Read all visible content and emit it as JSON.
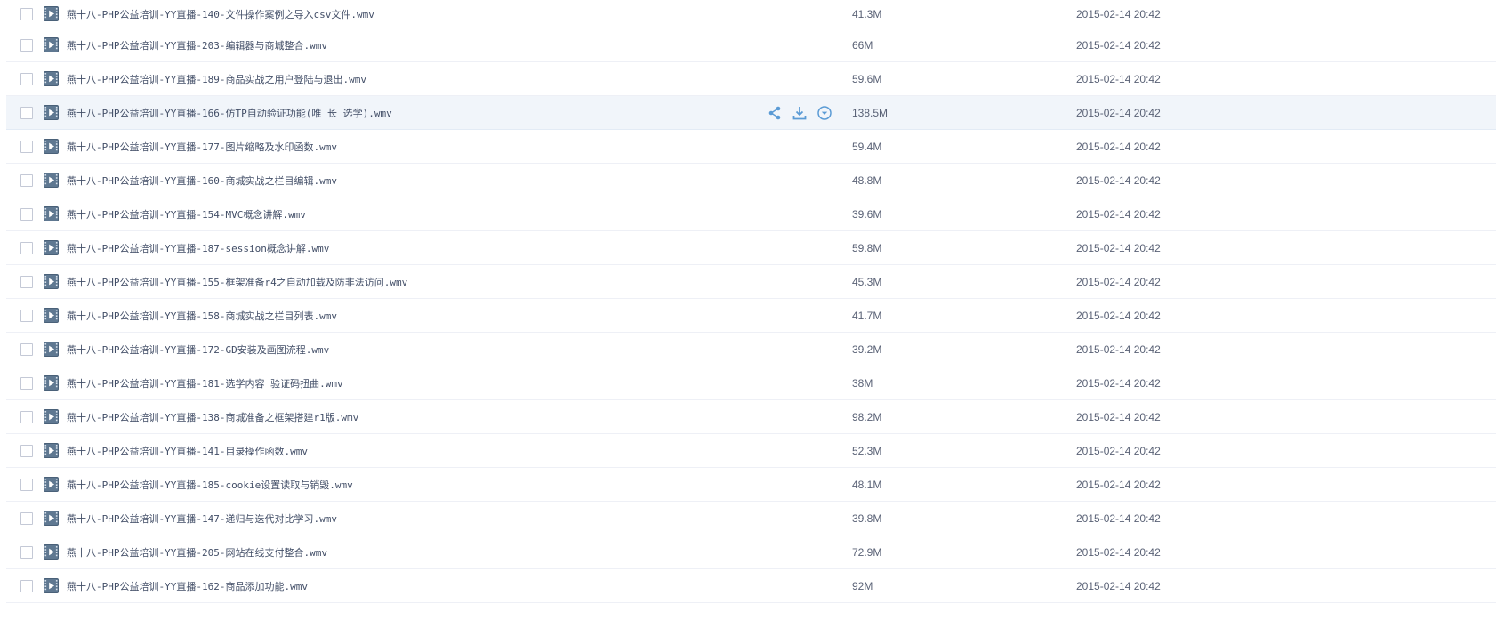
{
  "icons": {
    "file_type": "video-file-icon",
    "share": "share-icon",
    "download": "download-icon",
    "more": "chevron-down-circle-icon"
  },
  "colors": {
    "video_icon": "#5f7891",
    "action_icon": "#5b9bd5",
    "hover_row_bg": "#f1f5fa"
  },
  "files": [
    {
      "name": "燕十八-PHP公益培训-YY直播-140-文件操作案例之导入csv文件.wmv",
      "size": "41.3M",
      "modified": "2015-02-14 20:42",
      "hovered": false
    },
    {
      "name": "燕十八-PHP公益培训-YY直播-203-编辑器与商城整合.wmv",
      "size": "66M",
      "modified": "2015-02-14 20:42",
      "hovered": false
    },
    {
      "name": "燕十八-PHP公益培训-YY直播-189-商品实战之用户登陆与退出.wmv",
      "size": "59.6M",
      "modified": "2015-02-14 20:42",
      "hovered": false
    },
    {
      "name": "燕十八-PHP公益培训-YY直播-166-仿TP自动验证功能(唯 长 选学).wmv",
      "size": "138.5M",
      "modified": "2015-02-14 20:42",
      "hovered": true
    },
    {
      "name": "燕十八-PHP公益培训-YY直播-177-图片缩略及水印函数.wmv",
      "size": "59.4M",
      "modified": "2015-02-14 20:42",
      "hovered": false
    },
    {
      "name": "燕十八-PHP公益培训-YY直播-160-商城实战之栏目编辑.wmv",
      "size": "48.8M",
      "modified": "2015-02-14 20:42",
      "hovered": false
    },
    {
      "name": "燕十八-PHP公益培训-YY直播-154-MVC概念讲解.wmv",
      "size": "39.6M",
      "modified": "2015-02-14 20:42",
      "hovered": false
    },
    {
      "name": "燕十八-PHP公益培训-YY直播-187-session概念讲解.wmv",
      "size": "59.8M",
      "modified": "2015-02-14 20:42",
      "hovered": false
    },
    {
      "name": "燕十八-PHP公益培训-YY直播-155-框架准备r4之自动加载及防非法访问.wmv",
      "size": "45.3M",
      "modified": "2015-02-14 20:42",
      "hovered": false
    },
    {
      "name": "燕十八-PHP公益培训-YY直播-158-商城实战之栏目列表.wmv",
      "size": "41.7M",
      "modified": "2015-02-14 20:42",
      "hovered": false
    },
    {
      "name": "燕十八-PHP公益培训-YY直播-172-GD安装及画图流程.wmv",
      "size": "39.2M",
      "modified": "2015-02-14 20:42",
      "hovered": false
    },
    {
      "name": "燕十八-PHP公益培训-YY直播-181-选学内容 验证码扭曲.wmv",
      "size": "38M",
      "modified": "2015-02-14 20:42",
      "hovered": false
    },
    {
      "name": "燕十八-PHP公益培训-YY直播-138-商城准备之框架搭建r1版.wmv",
      "size": "98.2M",
      "modified": "2015-02-14 20:42",
      "hovered": false
    },
    {
      "name": "燕十八-PHP公益培训-YY直播-141-目录操作函数.wmv",
      "size": "52.3M",
      "modified": "2015-02-14 20:42",
      "hovered": false
    },
    {
      "name": "燕十八-PHP公益培训-YY直播-185-cookie设置读取与销毁.wmv",
      "size": "48.1M",
      "modified": "2015-02-14 20:42",
      "hovered": false
    },
    {
      "name": "燕十八-PHP公益培训-YY直播-147-递归与迭代对比学习.wmv",
      "size": "39.8M",
      "modified": "2015-02-14 20:42",
      "hovered": false
    },
    {
      "name": "燕十八-PHP公益培训-YY直播-205-网站在线支付整合.wmv",
      "size": "72.9M",
      "modified": "2015-02-14 20:42",
      "hovered": false
    },
    {
      "name": "燕十八-PHP公益培训-YY直播-162-商品添加功能.wmv",
      "size": "92M",
      "modified": "2015-02-14 20:42",
      "hovered": false
    }
  ]
}
